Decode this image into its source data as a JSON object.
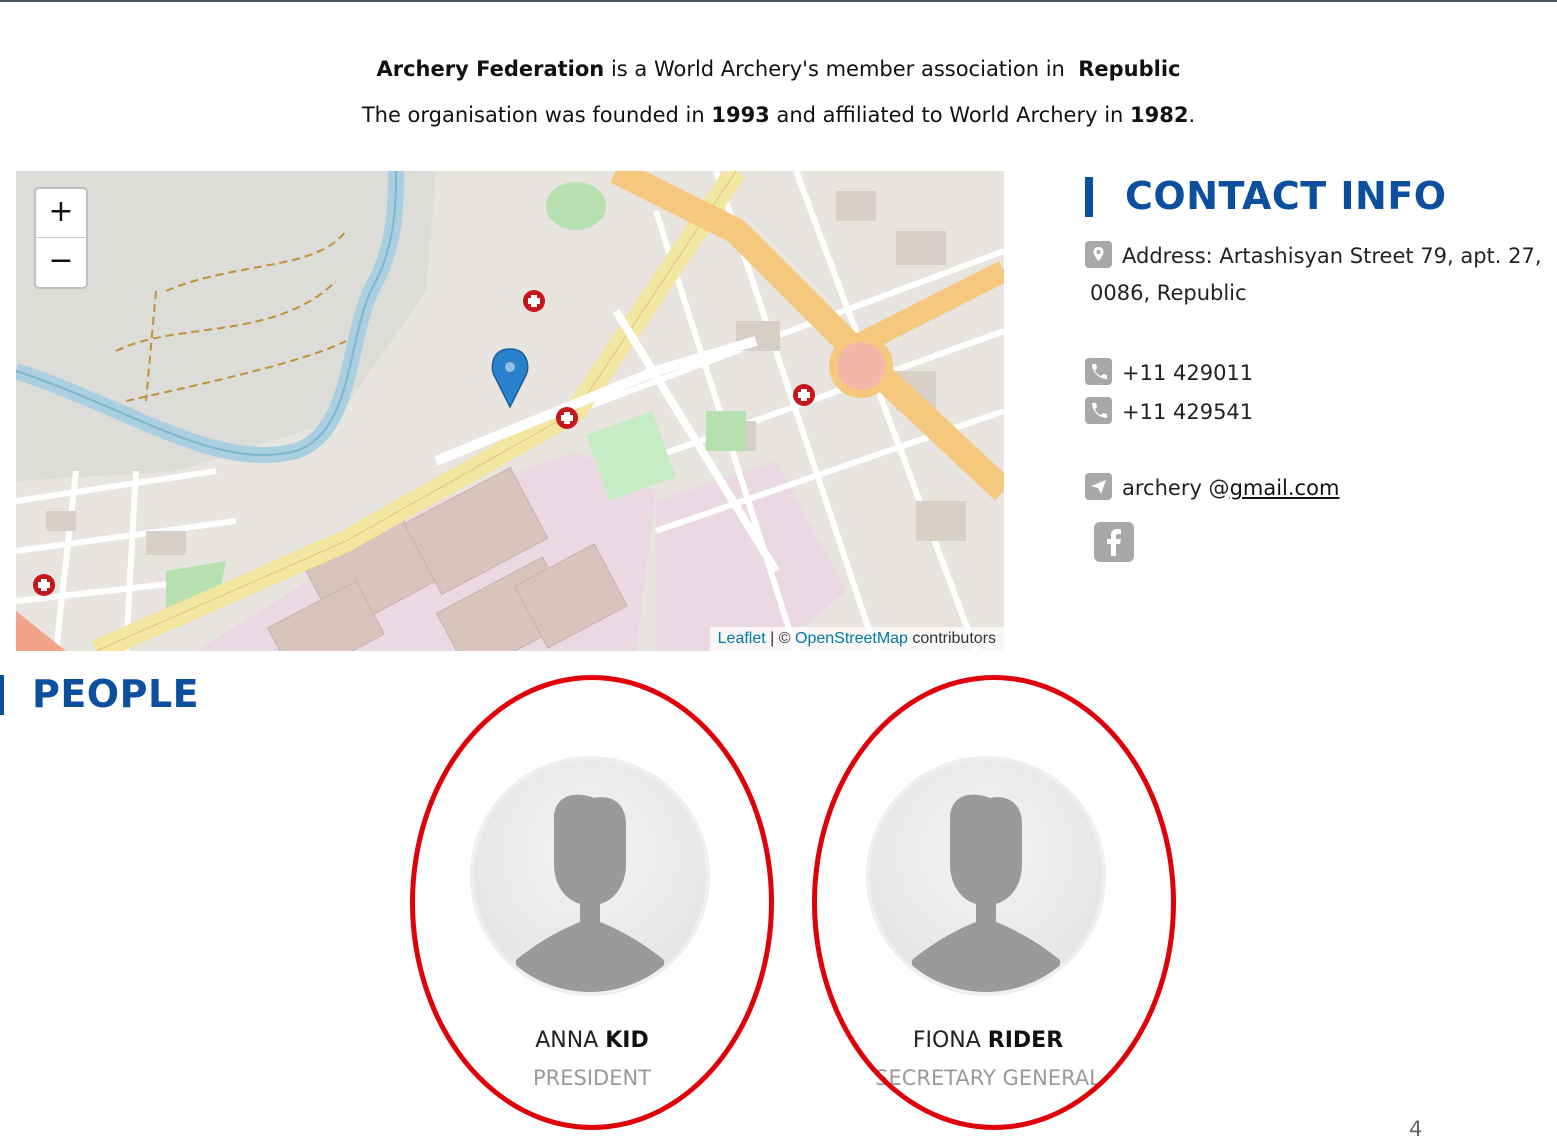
{
  "intro": {
    "line1_bold1": "Archery Federation",
    "line1_text": "is a World Archery's member association in",
    "line1_bold2": "Republic",
    "line2_text1": "The organisation was founded in",
    "line2_bold1": "1993",
    "line2_text2": "and affiliated to World Archery in",
    "line2_bold2": "1982",
    "line2_end": "."
  },
  "map": {
    "zoom_in": "+",
    "zoom_out": "−",
    "attribution_leaflet": "Leaflet",
    "attribution_sep": "| ©",
    "attribution_osm": "OpenStreetMap",
    "attribution_tail": "contributors",
    "marker": "map-marker-icon"
  },
  "contact": {
    "title": "CONTACT INFO",
    "address": "Address: Artashisyan Street 79, apt. 27,",
    "address_line2": "0086, Republic",
    "phone1": "+11 429011",
    "phone2": "+11 429541",
    "email_user": "archery @",
    "email_domain": "gmail.com",
    "social": "facebook-icon"
  },
  "people": {
    "title": "PEOPLE",
    "items": [
      {
        "first": "ANNA",
        "last": "KID",
        "role": "PRESIDENT"
      },
      {
        "first": "FIONA",
        "last": "RIDER",
        "role": "SECRETARY GENERAL"
      }
    ]
  },
  "page_number": "4",
  "colors": {
    "accent": "#0b4f9e",
    "annotation_ring": "#e0000a"
  }
}
